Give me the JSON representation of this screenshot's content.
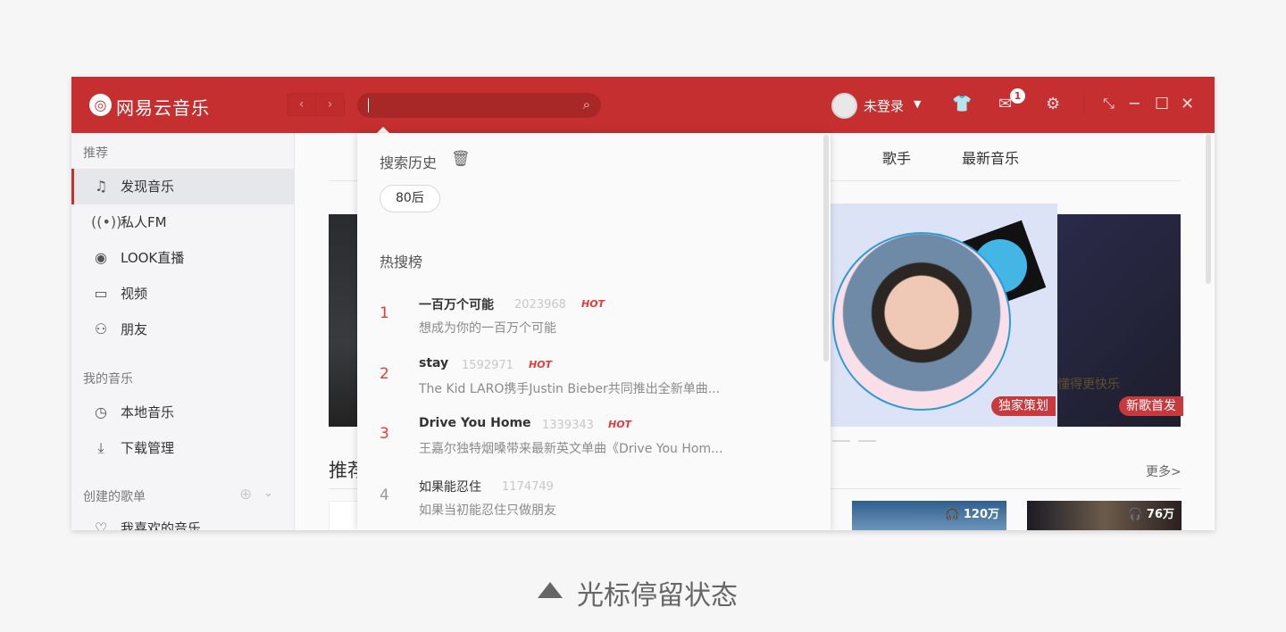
{
  "app": {
    "name": "网易云音乐",
    "logo_icon": "netease-cloud-music-logo",
    "brand_color": "#c62f2f"
  },
  "header": {
    "back": "‹",
    "forward": "›",
    "search": {
      "value": "",
      "placeholder": ""
    },
    "user": "未登录",
    "mail_badge": "1"
  },
  "sidebar": {
    "recommend_title": "推荐",
    "items": [
      {
        "label": "发现音乐",
        "icon": "music-note-icon"
      },
      {
        "label": "私人FM",
        "icon": "radio-icon"
      },
      {
        "label": "LOOK直播",
        "icon": "live-icon"
      },
      {
        "label": "视频",
        "icon": "video-icon"
      },
      {
        "label": "朋友",
        "icon": "friends-icon"
      }
    ],
    "my_music_title": "我的音乐",
    "my_items": [
      {
        "label": "本地音乐",
        "icon": "clock-icon"
      },
      {
        "label": "下载管理",
        "icon": "download-icon"
      }
    ],
    "playlists_title": "创建的歌单",
    "playlists": [
      {
        "label": "我喜欢的音乐"
      }
    ]
  },
  "main": {
    "tabs": [
      "歌手",
      "最新音乐"
    ],
    "banners": [
      {
        "tag": "独家策划"
      },
      {
        "tag": "新歌首发",
        "overlay": "懂得更快乐"
      }
    ],
    "section_title": "推荐歌单",
    "more": "更多>",
    "cards": [
      {
        "count": "120万"
      },
      {
        "count": "76万"
      }
    ]
  },
  "dropdown": {
    "history_title": "搜索历史",
    "history": [
      "80后"
    ],
    "hot_title": "热搜榜",
    "hot": [
      {
        "rank": "1",
        "title": "一百万个可能",
        "count": "2023968",
        "hot": "HOT",
        "desc": "想成为你的一百万个可能"
      },
      {
        "rank": "2",
        "title": "stay",
        "count": "1592971",
        "hot": "HOT",
        "desc": "The Kid LARO携手Justin Bieber共同推出全新单曲..."
      },
      {
        "rank": "3",
        "title": "Drive You Home",
        "count": "1339343",
        "hot": "HOT",
        "desc": "王嘉尔独特烟嗓带来最新英文单曲《Drive You Hom..."
      },
      {
        "rank": "4",
        "title": "如果能忍住",
        "count": "1174749",
        "hot": "",
        "desc": "如果当初能忍住只做朋友"
      }
    ]
  },
  "caption": "光标停留状态"
}
